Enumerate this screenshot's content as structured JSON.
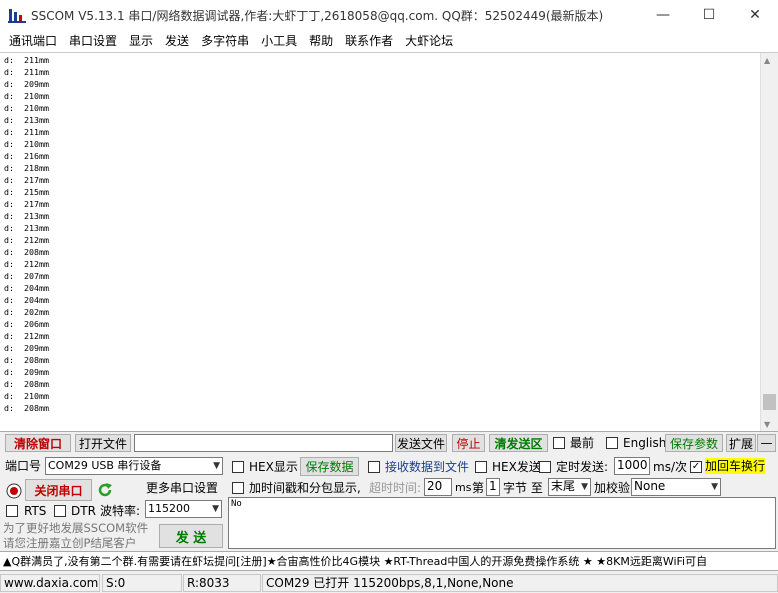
{
  "window": {
    "title": "SSCOM V5.13.1 串口/网络数据调试器,作者:大虾丁丁,2618058@qq.com. QQ群：52502449(最新版本)",
    "minimize": "—",
    "maximize": "☐",
    "close": "✕"
  },
  "menu": [
    "通讯端口",
    "串口设置",
    "显示",
    "发送",
    "多字符串",
    "小工具",
    "帮助",
    "联系作者",
    "大虾论坛"
  ],
  "receive_lines": [
    "d:  211mm",
    "d:  211mm",
    "d:  209mm",
    "d:  210mm",
    "d:  210mm",
    "d:  213mm",
    "d:  211mm",
    "d:  210mm",
    "d:  216mm",
    "d:  218mm",
    "d:  217mm",
    "d:  215mm",
    "d:  217mm",
    "d:  213mm",
    "d:  213mm",
    "d:  212mm",
    "d:  208mm",
    "d:  212mm",
    "d:  207mm",
    "d:  204mm",
    "d:  204mm",
    "d:  202mm",
    "d:  206mm",
    "d:  212mm",
    "d:  209mm",
    "d:  208mm",
    "d:  209mm",
    "d:  208mm",
    "d:  210mm",
    "d:  208mm"
  ],
  "toolbar": {
    "clear_window": "清除窗口",
    "open_file": "打开文件",
    "file_path": "",
    "send_file": "发送文件",
    "stop": "停止",
    "clear_send": "清发送区",
    "topmost": "最前",
    "english": "English",
    "save_params": "保存参数",
    "expand": "扩展",
    "collapse": "—"
  },
  "port": {
    "port_label": "端口号",
    "port_value": "COM29 USB 串行设备",
    "close_port": "关闭串口",
    "more_settings": "更多串口设置",
    "rts": "RTS",
    "dtr": "DTR",
    "baud_label": "波特率:",
    "baud_value": "115200",
    "promo": "为了更好地发展SSCOM软件\n请您注册嘉立创P结尾客户"
  },
  "options": {
    "hex_display": "HEX显示",
    "save_data": "保存数据",
    "recv_to_file": "接收数据到文件",
    "hex_send": "HEX发送",
    "timed_send": "定时发送:",
    "interval": "1000",
    "interval_unit": "ms/次",
    "crlf": "加回车换行",
    "timestamp": "加时间戳和分包显示,",
    "timeout_label": "超时时间:",
    "timeout_value": "20",
    "timeout_unit": "ms",
    "byte_prefix": "第",
    "byte_value": "1",
    "byte_label": "字节 至",
    "end_value": "末尾",
    "checksum_label": "加校验",
    "checksum_value": "None"
  },
  "send": {
    "text": "No",
    "send_button": "发  送"
  },
  "ticker": "▲Q群满员了,没有第二个群.有需要请在虾坛提问[注册]★合宙高性价比4G模块 ★RT-Thread中国人的开源免费操作系统 ★ ★8KM远距离WiFi可自",
  "status": {
    "url": "www.daxia.com",
    "sent": "S:0",
    "received": "R:8033",
    "port_status": "COM29 已打开  115200bps,8,1,None,None"
  }
}
